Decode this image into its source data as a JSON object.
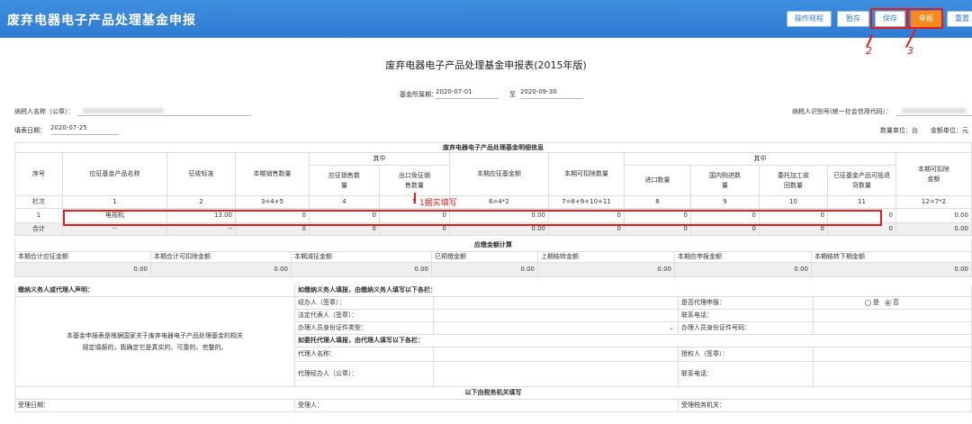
{
  "header": {
    "title": "废弃电器电子产品处理基金申报",
    "buttons": {
      "guide": "操作规程",
      "draft": "暂存",
      "save": "保存",
      "submit": "申报",
      "reset": "重置"
    }
  },
  "annotations": {
    "save_mark": "2",
    "submit_mark": "3",
    "fill_mark": "1据实填写"
  },
  "form": {
    "title": "废弃电器电子产品处理基金申报表(2015年版)",
    "period_label": "基金所属期：",
    "period_from": "2020-07-01",
    "period_sep": "至",
    "period_to": "2020-09-30",
    "taxpayer_name_label": "纳税人名称（公章）：",
    "taxpayer_id_label": "纳税人识别号(统一社会信用代码）：",
    "fill_date_label": "填表日期：",
    "fill_date": "2020-07-25",
    "unit_label": "数量单位：台",
    "amount_unit_label": "金额单位：元"
  },
  "table": {
    "caption": "废弃电器电子产品处理基金明细信息",
    "headers": {
      "seq": "序号",
      "product": "应征基金产品名称",
      "rate": "征收标准",
      "sales_qty": "本期销售数量",
      "of_which": "其中",
      "taxable_sales": "应征销售数量",
      "export_exempt": "出口免征销售数量",
      "fund_payable": "本期应征基金额",
      "deductible_qty": "本期可扣除数量",
      "of_which2": "其中",
      "import_qty": "进口数量",
      "domestic_qty": "国内购进数量",
      "processing_qty": "委托加工收回数量",
      "returned_qty": "已征基金产品可抵退货数量",
      "deductible_amount": "本期可扣除金额"
    },
    "col_index": [
      "栏次",
      "1",
      "2",
      "3=4+5",
      "4",
      "5",
      "6=4*2",
      "7=8+9+10+11",
      "8",
      "9",
      "10",
      "11",
      "12=7*2"
    ],
    "row1": [
      "1",
      "电视机",
      "13.00",
      "0",
      "0",
      "0",
      "0.00",
      "0",
      "0",
      "0",
      "0",
      "0",
      "0.00"
    ],
    "total": [
      "合计",
      "--",
      "--",
      "0",
      "0",
      "0",
      "0.00",
      "0",
      "0",
      "0",
      "0",
      "0",
      "0.00"
    ]
  },
  "calc": {
    "caption": "应缴金额计算",
    "labels": [
      "本期合计应征金额",
      "本期合计可扣除金额",
      "本期减征金额",
      "已预缴金额",
      "上期结转金额",
      "本期应申报金额",
      "本期结转下期金额"
    ],
    "values": [
      "0.00",
      "0.00",
      "0.00",
      "0.00",
      "0.00",
      "0.00",
      "0.00"
    ]
  },
  "declaration": {
    "left_title": "缴纳义务人或代理人声明：",
    "left_text": "本基金申报表是根据国家关于废弃电器电子产品处理基金的相关规定填报的，我确定它是真实的、可靠的、完整的。",
    "self_title": "如缴纳义务人填报，由缴纳义务人填写以下各栏：",
    "handler": "经办人（签章）：",
    "legal_rep": "法定代表人（签章）：",
    "id_type": "办理人员身份证件类型：",
    "agent_q": "是否代理申报：",
    "yes": "是",
    "no": "否",
    "phone": "联系电话：",
    "id_no": "办理人员身份证件号码：",
    "agent_title": "如委托代理人填报，由代理人填写以下各栏：",
    "agent_name": "代理人名称：",
    "agent_handler": "代理经办人（公章）：",
    "authorized": "授权人（签章）：",
    "agent_phone": "联系电话：",
    "tax_title": "以下由税务机关填写",
    "accept_date": "受理日期：",
    "acceptor": "受理人：",
    "accept_office": "受理税务机关："
  }
}
